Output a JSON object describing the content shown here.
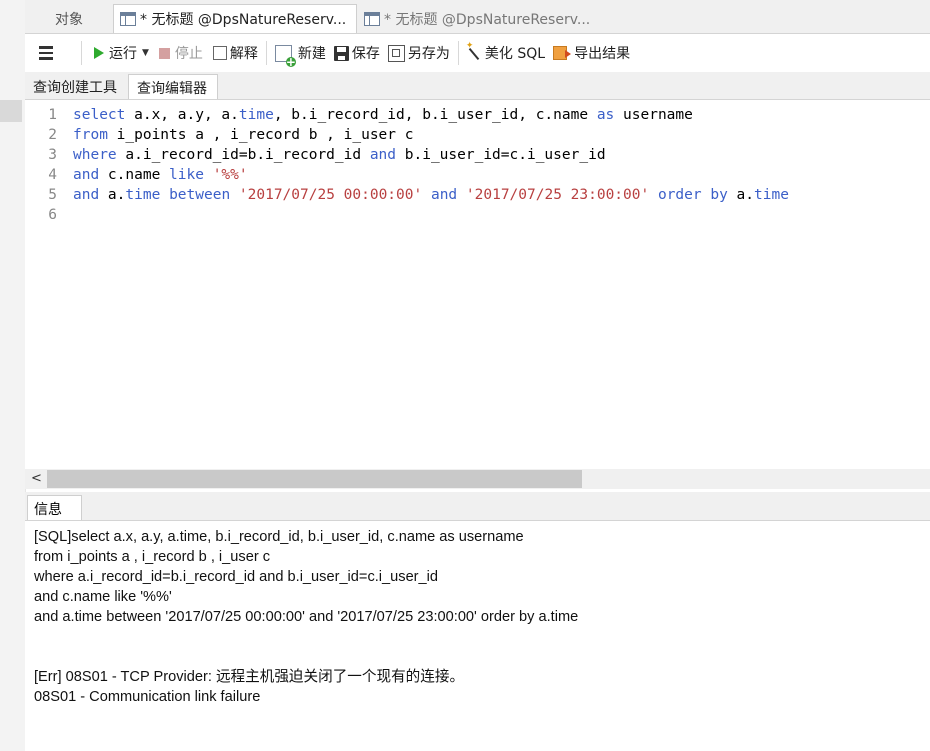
{
  "tabs": {
    "objects": "对象",
    "active": "* 无标题 @DpsNatureReserv...",
    "inactive": "* 无标题 @DpsNatureReserv..."
  },
  "toolbar": {
    "run": "运行",
    "stop": "停止",
    "explain": "解释",
    "new": "新建",
    "save": "保存",
    "save_as": "另存为",
    "beautify": "美化 SQL",
    "export": "导出结果"
  },
  "subtabs": {
    "query_builder": "查询创建工具",
    "query_editor": "查询编辑器"
  },
  "editor": {
    "line_numbers": [
      "1",
      "2",
      "3",
      "4",
      "5",
      "6"
    ],
    "lines": [
      [
        [
          "kw",
          "select"
        ],
        [
          "t",
          " a.x, a.y, a."
        ],
        [
          "kw",
          "time"
        ],
        [
          "t",
          ", b.i_record_id, b.i_user_id, c.name "
        ],
        [
          "kw",
          "as"
        ],
        [
          "t",
          " username"
        ]
      ],
      [
        [
          "kw",
          "from"
        ],
        [
          "t",
          " i_points a , i_record b , i_user c"
        ]
      ],
      [
        [
          "kw",
          "where"
        ],
        [
          "t",
          " a.i_record_id=b.i_record_id "
        ],
        [
          "kw",
          "and"
        ],
        [
          "t",
          " b.i_user_id=c.i_user_id"
        ]
      ],
      [
        [
          "kw",
          "and"
        ],
        [
          "t",
          " c.name "
        ],
        [
          "kw",
          "like"
        ],
        [
          "t",
          " "
        ],
        [
          "str",
          "'%%'"
        ]
      ],
      [
        [
          "kw",
          "and"
        ],
        [
          "t",
          " a."
        ],
        [
          "kw",
          "time"
        ],
        [
          "t",
          " "
        ],
        [
          "kw",
          "between"
        ],
        [
          "t",
          " "
        ],
        [
          "str",
          "'2017/07/25 00:00:00'"
        ],
        [
          "t",
          " "
        ],
        [
          "kw",
          "and"
        ],
        [
          "t",
          " "
        ],
        [
          "str",
          "'2017/07/25 23:00:00'"
        ],
        [
          "t",
          " "
        ],
        [
          "kw",
          "order by"
        ],
        [
          "t",
          " a."
        ],
        [
          "kw",
          "time"
        ]
      ],
      []
    ]
  },
  "info": {
    "tab_label": "信息",
    "lines": [
      "[SQL]select a.x, a.y, a.time, b.i_record_id, b.i_user_id, c.name as username",
      "from i_points a , i_record b , i_user c",
      "where a.i_record_id=b.i_record_id and b.i_user_id=c.i_user_id",
      "and c.name like '%%'",
      "and a.time between '2017/07/25 00:00:00' and '2017/07/25 23:00:00' order by a.time",
      "",
      "",
      "[Err] 08S01 - TCP Provider: 远程主机强迫关闭了一个现有的连接。",
      "08S01 - Communication link failure"
    ]
  },
  "colors": {
    "keyword": "#3b5fc8",
    "string": "#b84040",
    "run_icon": "#2eaa2e"
  }
}
